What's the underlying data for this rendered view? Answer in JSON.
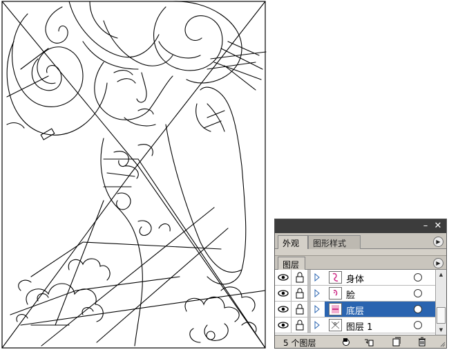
{
  "panel": {
    "title_controls": {
      "minimize": "–",
      "close": "✕"
    },
    "tabs": [
      {
        "label": "外观",
        "active": true
      },
      {
        "label": "图形样式",
        "active": false
      }
    ],
    "menu_icon": "flyout-menu-icon",
    "layers_tab_label": "图层",
    "layers": [
      {
        "name": "身体",
        "selected": false,
        "visible": true,
        "locked": false
      },
      {
        "name": "脸",
        "selected": false,
        "visible": true,
        "locked": false
      },
      {
        "name": "底层",
        "selected": true,
        "visible": true,
        "locked": false
      },
      {
        "name": "图层 1",
        "selected": false,
        "visible": true,
        "locked": false
      }
    ],
    "status": {
      "layer_count": "5 个图层",
      "buttons": [
        "make-clipping-mask-icon",
        "new-sublayer-icon",
        "new-layer-icon",
        "delete-layer-icon"
      ]
    }
  },
  "colors": {
    "titlebar": "#3c3c3c",
    "panel_bg": "#d4d0c8",
    "selection": "#2a64b0",
    "thumb_accent": "#d0308a"
  }
}
